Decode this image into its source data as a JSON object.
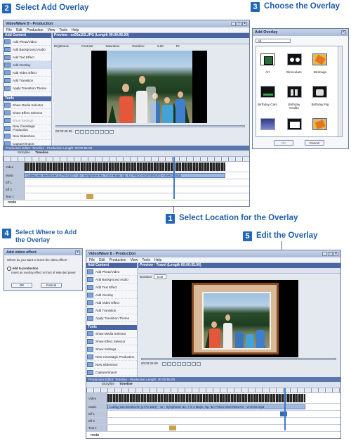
{
  "steps": {
    "s2": {
      "num": "2",
      "label": "Select Add Overlay"
    },
    "s3": {
      "num": "3",
      "label": "Choose the Overlay"
    },
    "s1": {
      "num": "1",
      "label": "Select Location for the Overlay"
    },
    "s4": {
      "num": "4",
      "label": "Select Where to Add the Overlay"
    },
    "s5": {
      "num": "5",
      "label": "Edit the Overlay"
    }
  },
  "top_window": {
    "title": "VideoWave 8 - Production",
    "menu": [
      "File",
      "Edit",
      "Production",
      "View",
      "Tools",
      "Help"
    ],
    "add_content_title": "Add Content",
    "tasks": [
      "Add Photo/Video",
      "Add Background Audio",
      "Add Text Effect",
      "Add Overlay",
      "Add Video Effect",
      "Add Transition",
      "Apply Transition Theme"
    ],
    "tools_title": "Tools",
    "tools": [
      "Show Media Selector",
      "Show Effect Selector",
      "Show Settings",
      "New CineMagic Production",
      "New Slideshow",
      "Capture/Import"
    ],
    "preview_title": "Preview - sx00a153.JPG (Length 00:00:05.00)",
    "props": {
      "brightness": "Brightness",
      "contrast": "Contrast",
      "saturation": "Saturation",
      "duration": "Duration:",
      "dur_value": "5.00",
      "fit": "Fit"
    },
    "timecode": "00:00:25.09",
    "editor_title": "Production Editor: Timeline - Production Length: 00:00:55.00",
    "view_storyline": "Storyline",
    "view_timeline": "Timeline",
    "tracks": [
      "Video",
      "Music",
      "Eff 1",
      "Eff 2",
      "Text 1"
    ],
    "audio_label": "Ludwig van Beethoven (1770-1827) - 16 - Symphonie No. 7 in A Major, Op. 92: POCO SOSTENUTO - VIVACE.mp3",
    "logo": "roxio"
  },
  "overlay_dialog": {
    "title": "Add Overlay",
    "filter": "All",
    "items": [
      "Art",
      "Binoculars",
      "Birdcage",
      "Birthday Cam",
      "Birthday Grafite",
      "Birthday Pig"
    ],
    "ok": "OK",
    "cancel": "Cancel"
  },
  "video_effect_dialog": {
    "title": "Add video effect",
    "question": "Where do you want to insert the video effect?",
    "option1": "Add to production",
    "option1_desc": "Insert an overlay effect in front of selected panel",
    "ok": "OK",
    "cancel": "Cancel"
  },
  "bottom_window": {
    "title": "VideoWave 8 - Production",
    "menu": [
      "File",
      "Edit",
      "Production",
      "View",
      "Tools",
      "Help"
    ],
    "add_content_title": "Add Content",
    "tasks": [
      "Add Photo/Video",
      "Add Background Audio",
      "Add Text Effect",
      "Add Overlay",
      "Add Video Effect",
      "Add Transition",
      "Apply Transition Theme"
    ],
    "tools_title": "Tools",
    "tools": [
      "Show Media Selector",
      "Show Effect Selector",
      "Show Settings",
      "New CineMagic Production",
      "New Slideshow",
      "Capture/Import"
    ],
    "preview_title": "Preview - Travel (Length 00:00:05.00)",
    "duration_label": "Duration:",
    "duration_value": "5.00",
    "timecode": "00:00:25.09",
    "editor_title": "Production Editor: Timeline - Production Length: 00:00:55.00",
    "view_storyline": "Storyline",
    "view_timeline": "Timeline",
    "tracks": [
      "Video",
      "Music",
      "Eff 1",
      "Eff 2",
      "Text 1"
    ],
    "audio_label": "Ludwig van Beethoven (1770-1827) - 16 - Symphonie No. 7 in A Major, Op. 92: POCO SOSTENUTO - VIVACE.mp3",
    "logo": "roxio"
  },
  "colors": {
    "step_blue": "#2167b8",
    "title_blue": "#1f5da8",
    "panel_blue": "#4a66a2"
  }
}
